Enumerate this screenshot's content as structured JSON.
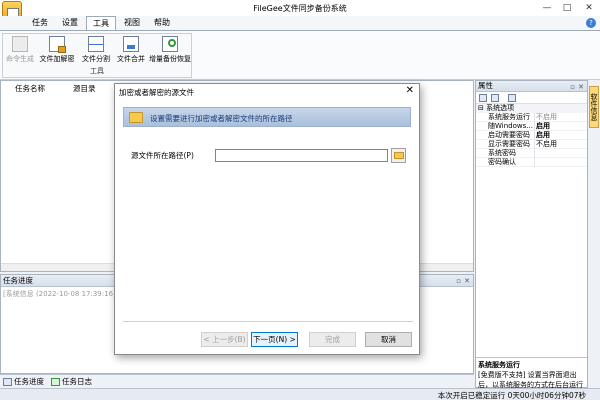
{
  "window": {
    "title": "FileGee文件同步备份系统"
  },
  "window_controls": [
    "—",
    "□",
    "✕"
  ],
  "ribbon": {
    "tabs": [
      {
        "label": "任务"
      },
      {
        "label": "设置"
      },
      {
        "label": "工具",
        "active": true
      },
      {
        "label": "视图"
      },
      {
        "label": "帮助"
      }
    ],
    "group_label": "工具",
    "buttons": {
      "cmd": "命令生成",
      "encrypt": "文件加解密",
      "split": "文件分割",
      "merge": "文件合并",
      "incremental": "增量备份恢复"
    }
  },
  "main_list": {
    "columns": [
      "任务名称",
      "源目录"
    ]
  },
  "progress_panel": {
    "title": "任务进度",
    "log": "[系统信息 (2022-10-08 17:39:16)]:"
  },
  "bottom_tabs": [
    "任务进度",
    "任务日志"
  ],
  "status": {
    "text": "本次开启已稳定运行 0天00小时06分钟07秒"
  },
  "properties": {
    "title": "属性",
    "category": "系统选项",
    "rows": [
      {
        "key": "系统服务运行",
        "value": "不启用",
        "style": "gray"
      },
      {
        "key": "随Windows...",
        "value": "启用",
        "style": "bold"
      },
      {
        "key": "启动需要密码",
        "value": "启用",
        "style": "bold"
      },
      {
        "key": "显示需要密码",
        "value": "不启用",
        "style": ""
      },
      {
        "key": "系统密码",
        "value": "",
        "style": ""
      },
      {
        "key": "密码确认",
        "value": "",
        "style": ""
      }
    ],
    "desc_title": "系统服务运行",
    "desc_text": "[免费版不支持] 设置当界面退出后，以系统服务的方式在后台运行",
    "side_tab": "软件信息"
  },
  "dialog": {
    "title": "加密或者解密的源文件",
    "banner": "设置需要进行加密或者解密文件的所在路径",
    "field_label": "源文件所在路径(P)",
    "field_value": "",
    "buttons": {
      "prev": "< 上一步(B)",
      "next": "下一页(N) >",
      "finish": "完成",
      "cancel": "取消"
    }
  },
  "colors": {
    "accent": "#0078d7",
    "banner": "#b8cbe4",
    "folder": "#f5c94c"
  }
}
